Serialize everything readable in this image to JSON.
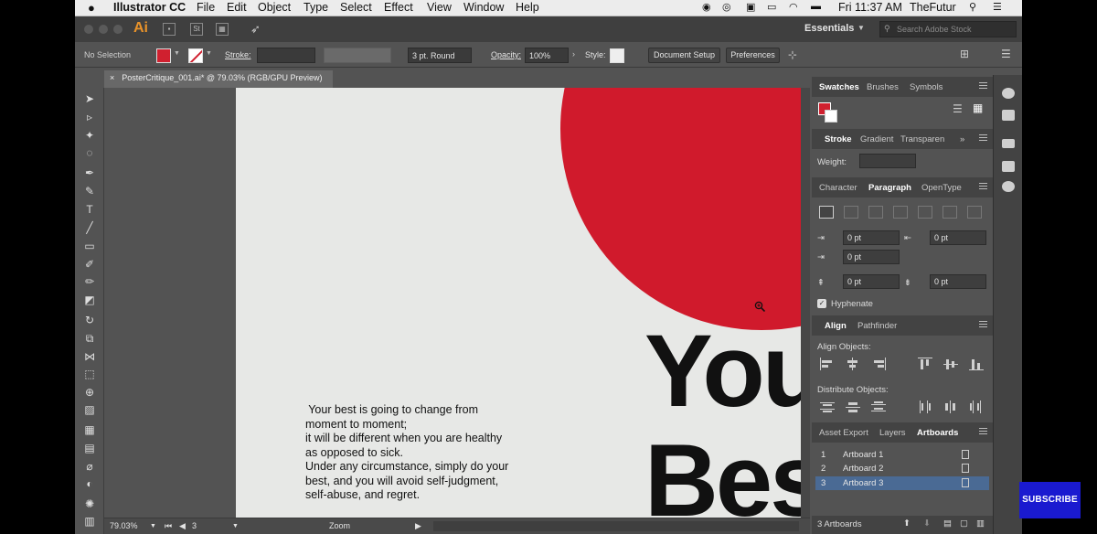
{
  "menubar": {
    "apple": "",
    "app_name": "Illustrator CC",
    "items": [
      "File",
      "Edit",
      "Object",
      "Type",
      "Select",
      "Effect",
      "View",
      "Window",
      "Help"
    ],
    "clock": "Fri 11:37 AM",
    "user": "TheFutur"
  },
  "appbar": {
    "logo": "Ai",
    "workspace": "Essentials",
    "search_placeholder": "Search Adobe Stock"
  },
  "controlbar": {
    "selection": "No Selection",
    "stroke_label": "Stroke:",
    "brush": "3 pt. Round",
    "opacity_label": "Opacity:",
    "opacity_value": "100%",
    "style_label": "Style:",
    "document_setup": "Document Setup",
    "preferences": "Preferences"
  },
  "document": {
    "tab_title": "PosterCritique_001.ai* @ 79.03% (RGB/GPU Preview)",
    "headline_1": "You",
    "headline_2": "Bes",
    "body_lines": [
      " Your best is going to change from",
      "moment to moment;",
      "it will be different when you are healthy",
      "as opposed to sick.",
      "Under any circumstance, simply do your",
      "best, and you will avoid self-judgment,",
      "self-abuse, and regret."
    ],
    "colors": {
      "accent": "#d01a2c",
      "artboard": "#e7e8e6",
      "text": "#111111"
    }
  },
  "statusbar": {
    "zoom": "79.03%",
    "artboard_number": "3",
    "tool": "Zoom"
  },
  "panels": {
    "swatches_tabs": [
      "Swatches",
      "Brushes",
      "Symbols"
    ],
    "stroke_tabs": [
      "Stroke",
      "Gradient",
      "Transparen"
    ],
    "weight_label": "Weight:",
    "text_tabs": [
      "Character",
      "Paragraph",
      "OpenType"
    ],
    "indent_values": [
      "0 pt",
      "0 pt",
      "0 pt",
      "0 pt",
      "0 pt"
    ],
    "hyphenate": "Hyphenate",
    "align_tabs": [
      "Align",
      "Pathfinder"
    ],
    "align_objects": "Align Objects:",
    "distribute_objects": "Distribute Objects:",
    "bottom_tabs": [
      "Asset Export",
      "Layers",
      "Artboards"
    ],
    "artboards": [
      {
        "num": "1",
        "name": "Artboard 1"
      },
      {
        "num": "2",
        "name": "Artboard 2"
      },
      {
        "num": "3",
        "name": "Artboard 3"
      }
    ],
    "artboard_count": "3 Artboards"
  },
  "overlay": {
    "subscribe": "SUBSCRIBE"
  }
}
